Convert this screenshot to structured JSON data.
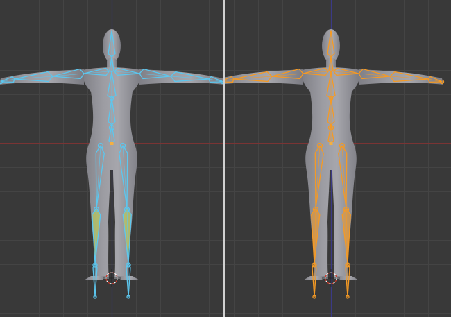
{
  "editor": {
    "layout": "split-3d-viewport",
    "background_color": "#393939",
    "grid_color": "#444444",
    "x_axis_color": "#7a3434",
    "z_axis_color": "#3b3a86",
    "mesh_color": "#9c9ca2"
  },
  "viewports": [
    {
      "name": "left",
      "mode": "edit-mode",
      "bone_color": "#5cc7ef",
      "highlight_color": "#c6d84a"
    },
    {
      "name": "right",
      "mode": "pose-mode",
      "bone_color": "#f59a24",
      "highlight_color": "#f59a24"
    }
  ]
}
